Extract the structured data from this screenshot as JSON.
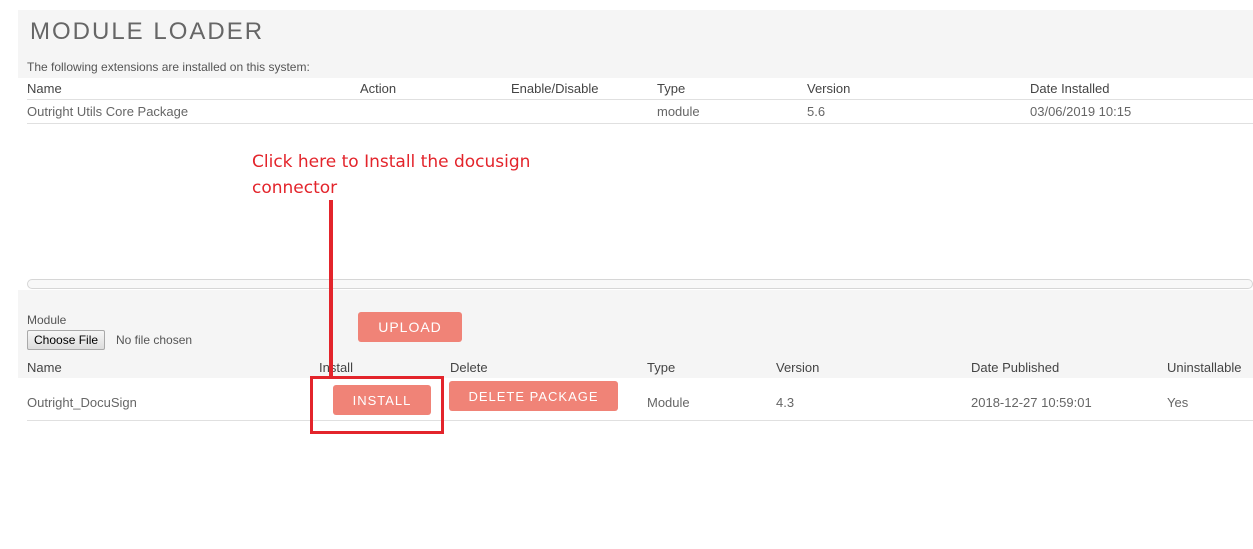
{
  "page": {
    "title": "MODULE LOADER",
    "intro": "The following extensions are installed on this system:"
  },
  "installed_table": {
    "headers": [
      "Name",
      "Action",
      "Enable/Disable",
      "Type",
      "Version",
      "Date Installed"
    ],
    "rows": [
      {
        "name": "Outright Utils Core Package",
        "type": "module",
        "version": "5.6",
        "date_installed": "03/06/2019 10:15"
      }
    ]
  },
  "upload": {
    "module_label": "Module",
    "choose_file_label": "Choose File",
    "no_file_text": "No file chosen",
    "upload_label": "UPLOAD"
  },
  "packages_table": {
    "headers": [
      "Name",
      "Install",
      "Delete",
      "Type",
      "Version",
      "Date Published",
      "Uninstallable"
    ],
    "rows": [
      {
        "name": "Outright_DocuSign",
        "install_label": "INSTALL",
        "delete_label": "DELETE PACKAGE",
        "type": "Module",
        "version": "4.3",
        "date_published": "2018-12-27 10:59:01",
        "uninstallable": "Yes"
      }
    ]
  },
  "annotation": {
    "text": "Click here to Install the docusign connector"
  },
  "colors": {
    "accent_button": "#f08377",
    "annotation_red": "#e3242b",
    "panel_bg": "#f5f5f5"
  }
}
